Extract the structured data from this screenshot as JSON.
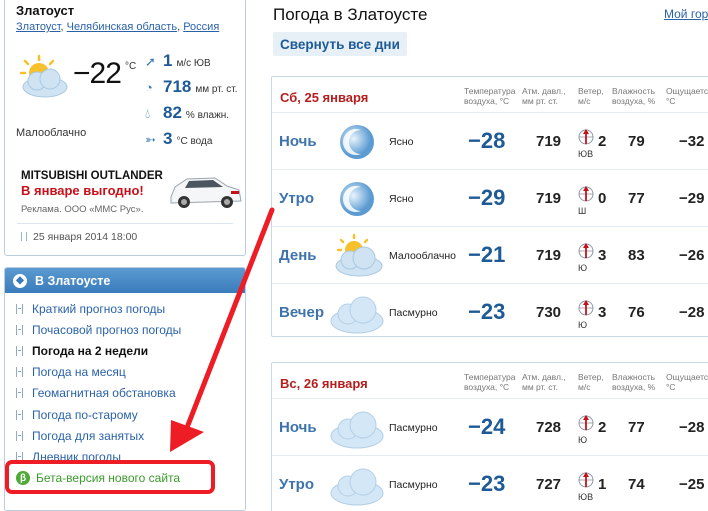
{
  "current": {
    "city": "Златоуст",
    "breadcrumb": [
      "Златоуст",
      "Челябинская область",
      "Россия"
    ],
    "temperature": "−22",
    "temperature_unit": "°C",
    "condition": "Малооблачно",
    "icon": "sun-cloud-icon",
    "params": [
      {
        "icon": "wind-arrow-icon",
        "value": "1",
        "unit": "м/с  ЮВ"
      },
      {
        "icon": "pressure-gauge-icon",
        "value": "718",
        "unit": "мм рт. ст."
      },
      {
        "icon": "humidity-drop-icon",
        "value": "82",
        "unit": "% влажн."
      },
      {
        "icon": "water-fish-icon",
        "value": "3",
        "unit": "°С вода"
      }
    ],
    "ad": {
      "title": "MITSUBISHI OUTLANDER",
      "subtitle": "В январе выгодно!",
      "note": "Реклама. ООО «ММС Рус»."
    },
    "updated": "25 января 2014 18:00"
  },
  "nav": {
    "title": "В Златоусте",
    "items": [
      {
        "label": "Краткий прогноз погоды",
        "state": "link"
      },
      {
        "label": "Почасовой прогноз погоды",
        "state": "link"
      },
      {
        "label": "Погода на 2 недели",
        "state": "active"
      },
      {
        "label": "Погода на месяц",
        "state": "link"
      },
      {
        "label": "Геомагнитная обстановка",
        "state": "link"
      },
      {
        "label": "Погода по-старому",
        "state": "link"
      },
      {
        "label": "Погода для занятых",
        "state": "link"
      },
      {
        "label": "Дневник погоды",
        "state": "link"
      },
      {
        "label": "Бета-версия нового сайта",
        "state": "beta"
      }
    ],
    "beta_badge": "β"
  },
  "main": {
    "title": "Погода в Златоусте",
    "my_link": "Мой гор",
    "collapse_label": "Свернуть все дни",
    "columns": {
      "temp": [
        "Температура",
        "воздуха, °С"
      ],
      "pressure": [
        "Атм. давл.,",
        "мм рт. ст."
      ],
      "wind": [
        "Ветер,",
        "м/с"
      ],
      "humidity": [
        "Влажность",
        "воздуха, %"
      ],
      "feels": [
        "Ощущается",
        "°С"
      ]
    },
    "days": [
      {
        "name": "Сб, 25 января",
        "rows": [
          {
            "part": "Ночь",
            "icon": "moon-clear-icon",
            "desc": "Ясно",
            "temp": "−28",
            "pressure": "719",
            "wind_dir": "ЮВ",
            "wind": "2",
            "humidity": "79",
            "feels": "−32"
          },
          {
            "part": "Утро",
            "icon": "moon-clear-icon",
            "desc": "Ясно",
            "temp": "−29",
            "pressure": "719",
            "wind_dir": "Ш",
            "wind": "0",
            "humidity": "77",
            "feels": "−29"
          },
          {
            "part": "День",
            "icon": "sun-cloud-icon",
            "desc": "Малооблачно",
            "temp": "−21",
            "pressure": "719",
            "wind_dir": "Ю",
            "wind": "3",
            "humidity": "83",
            "feels": "−26"
          },
          {
            "part": "Вечер",
            "icon": "cloud-icon",
            "desc": "Пасмурно",
            "temp": "−23",
            "pressure": "730",
            "wind_dir": "Ю",
            "wind": "3",
            "humidity": "76",
            "feels": "−28"
          }
        ]
      },
      {
        "name": "Вс, 26 января",
        "rows": [
          {
            "part": "Ночь",
            "icon": "cloud-icon",
            "desc": "Пасмурно",
            "temp": "−24",
            "pressure": "728",
            "wind_dir": "Ю",
            "wind": "2",
            "humidity": "77",
            "feels": "−28"
          },
          {
            "part": "Утро",
            "icon": "cloud-icon",
            "desc": "Пасмурно",
            "temp": "−23",
            "pressure": "727",
            "wind_dir": "ЮВ",
            "wind": "1",
            "humidity": "74",
            "feels": "−25"
          }
        ]
      }
    ]
  },
  "colors": {
    "accent": "#1d5a96",
    "link": "#2a62a8",
    "day_header": "#b61e1e",
    "highlight": "#ee1c24",
    "beta": "#3a9b2b"
  }
}
